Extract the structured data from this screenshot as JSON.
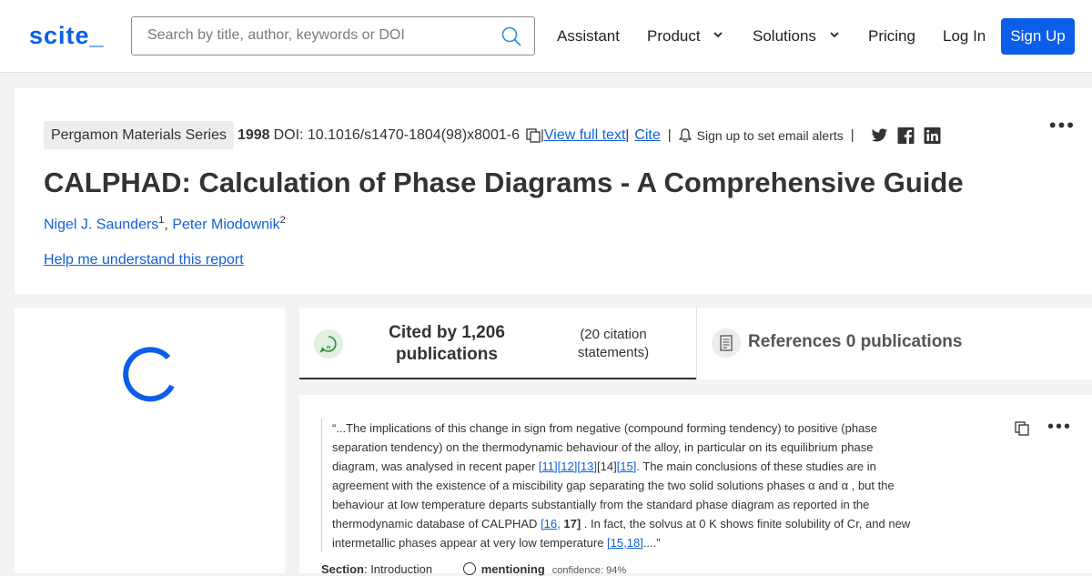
{
  "logo": "scite_",
  "search": {
    "placeholder": "Search by title, author, keywords or DOI"
  },
  "nav": {
    "assistant": "Assistant",
    "product": "Product",
    "solutions": "Solutions",
    "pricing": "Pricing",
    "login": "Log In",
    "signup": "Sign Up"
  },
  "paper": {
    "series": "Pergamon Materials Series",
    "year": "1998",
    "doi": "DOI: 10.1016/s1470-1804(98)x8001-6",
    "view_full_text": "View full text",
    "cite": "Cite",
    "alerts": "Sign up to set email alerts",
    "title": "CALPHAD: Calculation of Phase Diagrams - A Comprehensive Guide",
    "authors": [
      {
        "name": "Nigel J. Saunders",
        "sup": "1"
      },
      {
        "name": "Peter Miodownik",
        "sup": "2"
      }
    ],
    "help_link": "Help me understand this report"
  },
  "tabs": {
    "cited_by": "Cited by 1,206 publications",
    "citation_statements": "(20 citation statements)",
    "references": "References 0 publications"
  },
  "snippet": {
    "text_1": "“...The implications of this change in sign from negative (compound forming tendency) to positive (phase separation tendency) on the thermodynamic behaviour of the alloy, in particular on its equilibrium phase diagram, was analysed in recent paper ",
    "refs_a": [
      "[11]",
      "[12]",
      "[13]",
      "[14]",
      "[15]"
    ],
    "text_2": ". The main conclusions of these studies are in agreement with the existence of a miscibility gap separating the two solid solutions phases α and α , but the behaviour at low temperature departs substantially from the standard phase diagram as reported in the thermodynamic database of CALPHAD ",
    "ref_b1": "[16,",
    "ref_b2": "17]",
    "text_3": " . In fact, the solvus at 0 K shows finite solubility of Cr, and new intermetallic phases appear at very low temperature ",
    "ref_c": "[15,18]",
    "text_4": "....”",
    "section_label": "Section",
    "section_value": ": Introduction",
    "classification": "mentioning",
    "confidence": "confidence: 94%"
  },
  "colors": {
    "brand": "#0a5ee8",
    "link": "#1160d6",
    "background": "#f3f3f4"
  }
}
